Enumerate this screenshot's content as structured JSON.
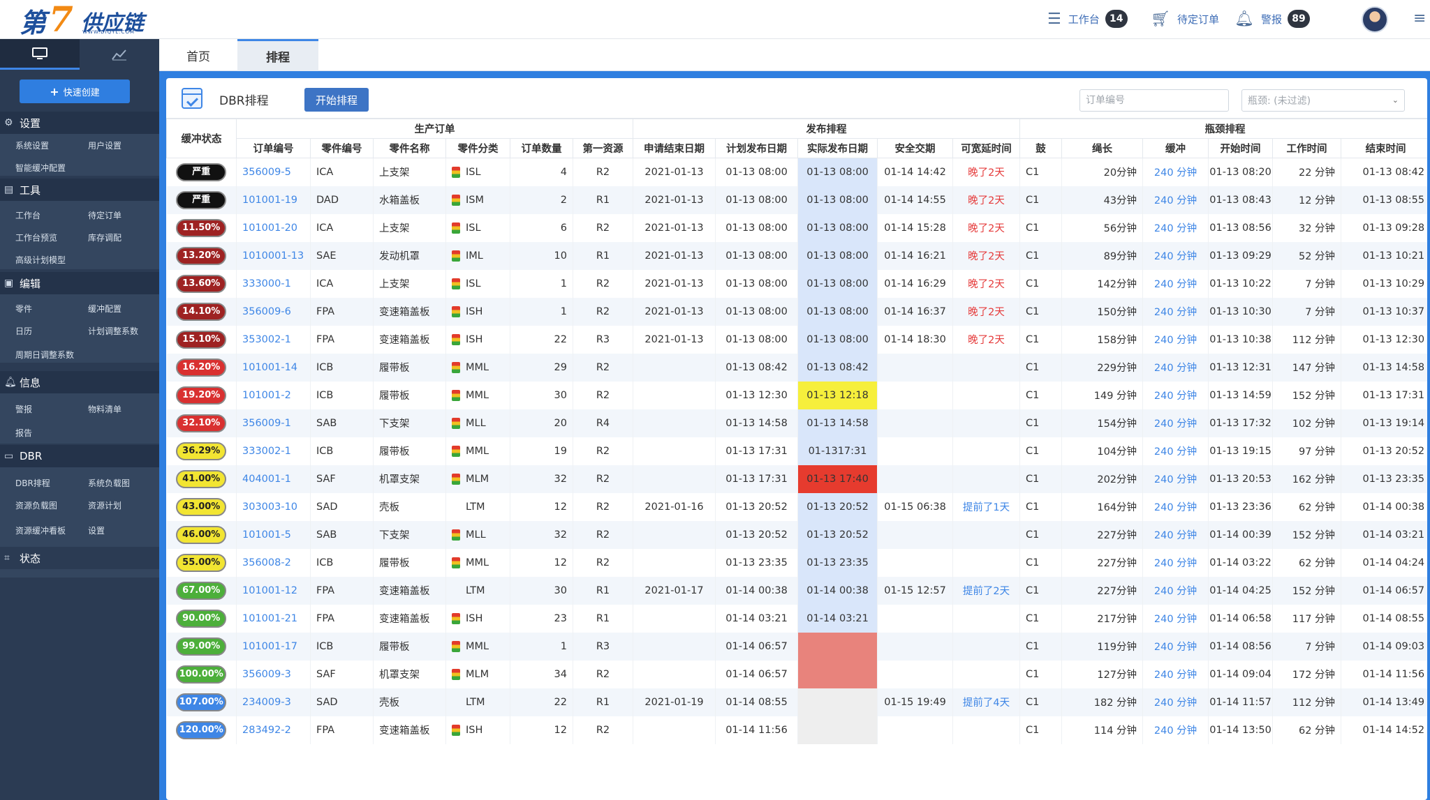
{
  "brand": {
    "logo_text_1": "第",
    "logo_text_7": "7",
    "logo_text_2": "供应链",
    "logo_url": "WWW.DIQYL.COM"
  },
  "topbar": {
    "workbench_label": "工作台",
    "workbench_count": "14",
    "pending_label": "待定订单",
    "alert_label": "警报",
    "alert_count": "89"
  },
  "sidebar": {
    "quick_create": "快速创建",
    "sections": [
      {
        "title": "设置",
        "items": [
          "系统设置",
          "用户设置",
          "智能缓冲配置"
        ]
      },
      {
        "title": "工具",
        "items": [
          "工作台",
          "待定订单",
          "工作台预览",
          "库存调配",
          "高级计划模型"
        ]
      },
      {
        "title": "编辑",
        "items": [
          "零件",
          "缓冲配置",
          "日历",
          "计划调整系数",
          "周期日调整系数"
        ]
      },
      {
        "title": "信息",
        "items": [
          "警报",
          "物料清单",
          "报告"
        ]
      },
      {
        "title": "DBR",
        "items": [
          "DBR排程",
          "系统负载图",
          "资源负载图",
          "资源计划",
          "资源缓冲看板",
          "设置"
        ]
      },
      {
        "title": "状态",
        "items": []
      }
    ]
  },
  "tabs": [
    "首页",
    "排程"
  ],
  "panel": {
    "title": "DBR排程",
    "start_button": "开始排程",
    "order_placeholder": "订单编号",
    "bottleneck_select": "瓶颈: (未过滤)"
  },
  "table": {
    "group_headers": [
      "缓冲状态",
      "生产订单",
      "发布排程",
      "瓶颈排程"
    ],
    "columns": [
      "订单编号",
      "零件编号",
      "零件名称",
      "零件分类",
      "订单数量",
      "第一资源",
      "申请结束日期",
      "计划发布日期",
      "实际发布日期",
      "安全交期",
      "可宽延时间",
      "鼓",
      "绳长",
      "缓冲",
      "开始时间",
      "工作时间",
      "结束时间"
    ],
    "rows": [
      {
        "status": "严重",
        "status_color": "#111111",
        "status_text": "#ffffff",
        "order": "356009-5",
        "part": "ICA",
        "name": "上支架",
        "cat_icon": true,
        "cat": "ISL",
        "qty": "4",
        "res": "R2",
        "req_end": "2021-01-13",
        "plan_rel": "01-13 08:00",
        "act_rel": "01-13 08:00",
        "act_bg": "",
        "safe": "01-14 14:42",
        "slack": "晚了2天",
        "slack_color": "red",
        "drum": "C1",
        "rope": "20分钟",
        "buffer": "240 分钟",
        "start": "01-13 08:20",
        "work": "22 分钟",
        "end": "01-13 08:42"
      },
      {
        "status": "严重",
        "status_color": "#111111",
        "status_text": "#ffffff",
        "order": "101001-19",
        "part": "DAD",
        "name": "水箱盖板",
        "cat_icon": true,
        "cat": "ISM",
        "qty": "2",
        "res": "R1",
        "req_end": "2021-01-13",
        "plan_rel": "01-13 08:00",
        "act_rel": "01-13 08:00",
        "act_bg": "",
        "safe": "01-14 14:55",
        "slack": "晚了2天",
        "slack_color": "red",
        "drum": "C1",
        "rope": "43分钟",
        "buffer": "240 分钟",
        "start": "01-13 08:43",
        "work": "12 分钟",
        "end": "01-13 08:55"
      },
      {
        "status": "11.50%",
        "status_color": "#9e2222",
        "status_text": "#ffffff",
        "order": "101001-20",
        "part": "ICA",
        "name": "上支架",
        "cat_icon": true,
        "cat": "ISL",
        "qty": "6",
        "res": "R2",
        "req_end": "2021-01-13",
        "plan_rel": "01-13 08:00",
        "act_rel": "01-13 08:00",
        "act_bg": "",
        "safe": "01-14 15:28",
        "slack": "晚了2天",
        "slack_color": "red",
        "drum": "C1",
        "rope": "56分钟",
        "buffer": "240 分钟",
        "start": "01-13 08:56",
        "work": "32 分钟",
        "end": "01-13 09:28"
      },
      {
        "status": "13.20%",
        "status_color": "#9e2222",
        "status_text": "#ffffff",
        "order": "1010001-13",
        "part": "SAE",
        "name": "发动机罩",
        "cat_icon": true,
        "cat": "IML",
        "qty": "10",
        "res": "R1",
        "req_end": "2021-01-13",
        "plan_rel": "01-13 08:00",
        "act_rel": "01-13 08:00",
        "act_bg": "",
        "safe": "01-14 16:21",
        "slack": "晚了2天",
        "slack_color": "red",
        "drum": "C1",
        "rope": "89分钟",
        "buffer": "240 分钟",
        "start": "01-13 09:29",
        "work": "52 分钟",
        "end": "01-13 10:21"
      },
      {
        "status": "13.60%",
        "status_color": "#9e2222",
        "status_text": "#ffffff",
        "order": "333000-1",
        "part": "ICA",
        "name": "上支架",
        "cat_icon": true,
        "cat": "ISL",
        "qty": "1",
        "res": "R2",
        "req_end": "2021-01-13",
        "plan_rel": "01-13 08:00",
        "act_rel": "01-13 08:00",
        "act_bg": "",
        "safe": "01-14 16:29",
        "slack": "晚了2天",
        "slack_color": "red",
        "drum": "C1",
        "rope": "142分钟",
        "buffer": "240 分钟",
        "start": "01-13 10:22",
        "work": "7 分钟",
        "end": "01-13 10:29"
      },
      {
        "status": "14.10%",
        "status_color": "#9e2222",
        "status_text": "#ffffff",
        "order": "356009-6",
        "part": "FPA",
        "name": "变速箱盖板",
        "cat_icon": true,
        "cat": "ISH",
        "qty": "1",
        "res": "R2",
        "req_end": "2021-01-13",
        "plan_rel": "01-13 08:00",
        "act_rel": "01-13 08:00",
        "act_bg": "",
        "safe": "01-14 16:37",
        "slack": "晚了2天",
        "slack_color": "red",
        "drum": "C1",
        "rope": "150分钟",
        "buffer": "240 分钟",
        "start": "01-13 10:30",
        "work": "7 分钟",
        "end": "01-13 10:37"
      },
      {
        "status": "15.10%",
        "status_color": "#9e2222",
        "status_text": "#ffffff",
        "order": "353002-1",
        "part": "FPA",
        "name": "变速箱盖板",
        "cat_icon": true,
        "cat": "ISH",
        "qty": "22",
        "res": "R3",
        "req_end": "2021-01-13",
        "plan_rel": "01-13 08:00",
        "act_rel": "01-13 08:00",
        "act_bg": "",
        "safe": "01-14 18:30",
        "slack": "晚了2天",
        "slack_color": "red",
        "drum": "C1",
        "rope": "158分钟",
        "buffer": "240 分钟",
        "start": "01-13 10:38",
        "work": "112 分钟",
        "end": "01-13 12:30"
      },
      {
        "status": "16.20%",
        "status_color": "#d93030",
        "status_text": "#ffffff",
        "order": "101001-14",
        "part": "ICB",
        "name": "履带板",
        "cat_icon": true,
        "cat": "MML",
        "qty": "29",
        "res": "R2",
        "req_end": "",
        "plan_rel": "01-13 08:42",
        "act_rel": "01-13 08:42",
        "act_bg": "",
        "safe": "",
        "slack": "",
        "slack_color": "",
        "drum": "C1",
        "rope": "229分钟",
        "buffer": "240 分钟",
        "start": "01-13 12:31",
        "work": "147 分钟",
        "end": "01-13 14:58"
      },
      {
        "status": "19.20%",
        "status_color": "#d93030",
        "status_text": "#ffffff",
        "order": "101001-2",
        "part": "ICB",
        "name": "履带板",
        "cat_icon": true,
        "cat": "MML",
        "qty": "30",
        "res": "R2",
        "req_end": "",
        "plan_rel": "01-13 12:30",
        "act_rel": "01-13 12:18",
        "act_bg": "#f6ef3c",
        "safe": "",
        "slack": "",
        "slack_color": "",
        "drum": "C1",
        "rope": "149 分钟",
        "buffer": "240 分钟",
        "start": "01-13 14:59",
        "work": "152 分钟",
        "end": "01-13 17:31"
      },
      {
        "status": "32.10%",
        "status_color": "#d93030",
        "status_text": "#ffffff",
        "order": "356009-1",
        "part": "SAB",
        "name": "下支架",
        "cat_icon": true,
        "cat": "MLL",
        "qty": "20",
        "res": "R4",
        "req_end": "",
        "plan_rel": "01-13 14:58",
        "act_rel": "01-13 14:58",
        "act_bg": "",
        "safe": "",
        "slack": "",
        "slack_color": "",
        "drum": "C1",
        "rope": "154分钟",
        "buffer": "240 分钟",
        "start": "01-13 17:32",
        "work": "102 分钟",
        "end": "01-13 19:14"
      },
      {
        "status": "36.29%",
        "status_color": "#f2e532",
        "status_text": "#222222",
        "order": "333002-1",
        "part": "ICB",
        "name": "履带板",
        "cat_icon": true,
        "cat": "MML",
        "qty": "19",
        "res": "R2",
        "req_end": "",
        "plan_rel": "01-13 17:31",
        "act_rel": "01-1317:31",
        "act_bg": "",
        "safe": "",
        "slack": "",
        "slack_color": "",
        "drum": "C1",
        "rope": "104分钟",
        "buffer": "240 分钟",
        "start": "01-13 19:15",
        "work": "97 分钟",
        "end": "01-13 20:52"
      },
      {
        "status": "41.00%",
        "status_color": "#f2e532",
        "status_text": "#222222",
        "order": "404001-1",
        "part": "SAF",
        "name": "机罩支架",
        "cat_icon": true,
        "cat": "MLM",
        "qty": "32",
        "res": "R2",
        "req_end": "",
        "plan_rel": "01-13 17:31",
        "act_rel": "01-13 17:40",
        "act_bg": "#e63b2e",
        "safe": "",
        "slack": "",
        "slack_color": "",
        "drum": "C1",
        "rope": "202分钟",
        "buffer": "240 分钟",
        "start": "01-13 20:53",
        "work": "162 分钟",
        "end": "01-13 23:35"
      },
      {
        "status": "43.00%",
        "status_color": "#f2e532",
        "status_text": "#222222",
        "order": "303003-10",
        "part": "SAD",
        "name": "壳板",
        "cat_icon": false,
        "cat": "LTM",
        "qty": "12",
        "res": "R2",
        "req_end": "2021-01-16",
        "plan_rel": "01-13 20:52",
        "act_rel": "01-13 20:52",
        "act_bg": "",
        "safe": "01-15 06:38",
        "slack": "提前了1天",
        "slack_color": "blue",
        "drum": "C1",
        "rope": "164分钟",
        "buffer": "240 分钟",
        "start": "01-13 23:36",
        "work": "62 分钟",
        "end": "01-14 00:38"
      },
      {
        "status": "46.00%",
        "status_color": "#f2e532",
        "status_text": "#222222",
        "order": "101001-5",
        "part": "SAB",
        "name": "下支架",
        "cat_icon": true,
        "cat": "MLL",
        "qty": "32",
        "res": "R2",
        "req_end": "",
        "plan_rel": "01-13 20:52",
        "act_rel": "01-13 20:52",
        "act_bg": "",
        "safe": "",
        "slack": "",
        "slack_color": "",
        "drum": "C1",
        "rope": "227分钟",
        "buffer": "240 分钟",
        "start": "01-14 00:39",
        "work": "152 分钟",
        "end": "01-14 03:21"
      },
      {
        "status": "55.00%",
        "status_color": "#f2e532",
        "status_text": "#222222",
        "order": "356008-2",
        "part": "ICB",
        "name": "履带板",
        "cat_icon": true,
        "cat": "MML",
        "qty": "12",
        "res": "R2",
        "req_end": "",
        "plan_rel": "01-13 23:35",
        "act_rel": "01-13 23:35",
        "act_bg": "",
        "safe": "",
        "slack": "",
        "slack_color": "",
        "drum": "C1",
        "rope": "227分钟",
        "buffer": "240 分钟",
        "start": "01-14 03:22",
        "work": "62 分钟",
        "end": "01-14 04:24"
      },
      {
        "status": "67.00%",
        "status_color": "#4caf3a",
        "status_text": "#ffffff",
        "order": "101001-12",
        "part": "FPA",
        "name": "变速箱盖板",
        "cat_icon": false,
        "cat": "LTM",
        "qty": "30",
        "res": "R1",
        "req_end": "2021-01-17",
        "plan_rel": "01-14 00:38",
        "act_rel": "01-14 00:38",
        "act_bg": "",
        "safe": "01-15 12:57",
        "slack": "提前了2天",
        "slack_color": "blue",
        "drum": "C1",
        "rope": "227分钟",
        "buffer": "240 分钟",
        "start": "01-14 04:25",
        "work": "152 分钟",
        "end": "01-14 06:57"
      },
      {
        "status": "90.00%",
        "status_color": "#4caf3a",
        "status_text": "#ffffff",
        "order": "101001-21",
        "part": "FPA",
        "name": "变速箱盖板",
        "cat_icon": true,
        "cat": "ISH",
        "qty": "23",
        "res": "R1",
        "req_end": "",
        "plan_rel": "01-14 03:21",
        "act_rel": "01-14 03:21",
        "act_bg": "",
        "safe": "",
        "slack": "",
        "slack_color": "",
        "drum": "C1",
        "rope": "217分钟",
        "buffer": "240 分钟",
        "start": "01-14 06:58",
        "work": "117 分钟",
        "end": "01-14 08:55"
      },
      {
        "status": "99.00%",
        "status_color": "#4caf3a",
        "status_text": "#ffffff",
        "order": "101001-17",
        "part": "ICB",
        "name": "履带板",
        "cat_icon": true,
        "cat": "MML",
        "qty": "1",
        "res": "R3",
        "req_end": "",
        "plan_rel": "01-14 06:57",
        "act_rel": "",
        "act_bg": "#e8837c",
        "safe": "",
        "slack": "",
        "slack_color": "",
        "drum": "C1",
        "rope": "119分钟",
        "buffer": "240 分钟",
        "start": "01-14 08:56",
        "work": "7 分钟",
        "end": "01-14 09:03"
      },
      {
        "status": "100.00%",
        "status_color": "#4caf3a",
        "status_text": "#ffffff",
        "order": "356009-3",
        "part": "SAF",
        "name": "机罩支架",
        "cat_icon": true,
        "cat": "MLM",
        "qty": "34",
        "res": "R2",
        "req_end": "",
        "plan_rel": "01-14 06:57",
        "act_rel": "",
        "act_bg": "#e8837c",
        "safe": "",
        "slack": "",
        "slack_color": "",
        "drum": "C1",
        "rope": "127分钟",
        "buffer": "240 分钟",
        "start": "01-14 09:04",
        "work": "172 分钟",
        "end": "01-14 11:56"
      },
      {
        "status": "107.00%",
        "status_color": "#3e86e6",
        "status_text": "#ffffff",
        "order": "234009-3",
        "part": "SAD",
        "name": "壳板",
        "cat_icon": false,
        "cat": "LTM",
        "qty": "22",
        "res": "R1",
        "req_end": "2021-01-19",
        "plan_rel": "01-14 08:55",
        "act_rel": "",
        "act_bg": "#eeeeee",
        "safe": "01-15 19:49",
        "slack": "提前了4天",
        "slack_color": "blue",
        "drum": "C1",
        "rope": "182 分钟",
        "buffer": "240 分钟",
        "start": "01-14 11:57",
        "work": "112 分钟",
        "end": "01-14 13:49"
      },
      {
        "status": "120.00%",
        "status_color": "#3e86e6",
        "status_text": "#ffffff",
        "order": "283492-2",
        "part": "FPA",
        "name": "变速箱盖板",
        "cat_icon": true,
        "cat": "ISH",
        "qty": "12",
        "res": "R2",
        "req_end": "",
        "plan_rel": "01-14 11:56",
        "act_rel": "",
        "act_bg": "#eeeeee",
        "safe": "",
        "slack": "",
        "slack_color": "",
        "drum": "C1",
        "rope": "114 分钟",
        "buffer": "240 分钟",
        "start": "01-14 13:50",
        "work": "62 分钟",
        "end": "01-14 14:52"
      }
    ]
  }
}
